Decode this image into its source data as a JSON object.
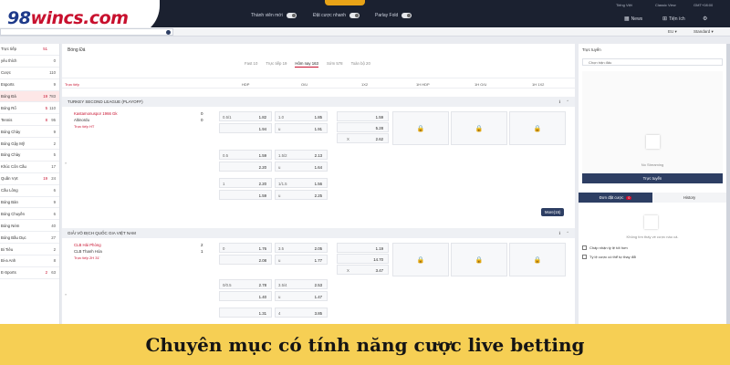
{
  "brand": {
    "logo_prefix": "98",
    "logo_rest": "wincs.com"
  },
  "topbar": {
    "toggles": [
      {
        "label": "Thành viên mới"
      },
      {
        "label": "Đặt cược nhanh"
      },
      {
        "label": "Parlay Fold"
      }
    ],
    "top_right": {
      "lang": "Tiếng Việt",
      "view": "Classic View",
      "time": "GMT+08:00"
    },
    "icons": [
      {
        "label": "News",
        "icon": "news-icon"
      },
      {
        "label": "Tiện ích",
        "icon": "apps-icon"
      },
      {
        "label": "Settings",
        "icon": "gear-icon"
      }
    ],
    "odds_format": "EU",
    "market_mode": "Standard"
  },
  "search": {
    "placeholder": ""
  },
  "sidebar": {
    "items": [
      {
        "label": "Trực tiếp",
        "n1": "51",
        "n2": ""
      },
      {
        "label": "yêu thích",
        "n1": "",
        "n2": "0"
      },
      {
        "label": "Cược",
        "n1": "",
        "n2": "110"
      },
      {
        "label": "Esports",
        "n1": "",
        "n2": "9"
      },
      {
        "label": "Bóng Đá",
        "n1": "19",
        "n2": "783"
      },
      {
        "label": "Bóng Rổ",
        "n1": "5",
        "n2": "110"
      },
      {
        "label": "Tennis",
        "n1": "8",
        "n2": "95"
      },
      {
        "label": "Bóng Chày",
        "n1": "",
        "n2": "9"
      },
      {
        "label": "Bóng Gậy Mỹ",
        "n1": "",
        "n2": "2"
      },
      {
        "label": "Bóng Chày",
        "n1": "",
        "n2": "5"
      },
      {
        "label": "Khúc Côn Cầu",
        "n1": "",
        "n2": "17"
      },
      {
        "label": "Quần Vợt",
        "n1": "19",
        "n2": "24"
      },
      {
        "label": "Cầu Lông",
        "n1": "",
        "n2": "6"
      },
      {
        "label": "Bóng Bàn",
        "n1": "",
        "n2": "9"
      },
      {
        "label": "Bóng Chuyền",
        "n1": "",
        "n2": "6"
      },
      {
        "label": "Bóng Ném",
        "n1": "",
        "n2": "40"
      },
      {
        "label": "Bóng Bầu Dục",
        "n1": "",
        "n2": "27"
      },
      {
        "label": "Bi Tiêu",
        "n1": "",
        "n2": "2"
      },
      {
        "label": "Bi-a Anh",
        "n1": "",
        "n2": "8"
      },
      {
        "label": "E-Sports",
        "n1": "2",
        "n2": "63"
      }
    ]
  },
  "main": {
    "title": "Bóng Đá",
    "tabs": [
      {
        "label": "Fast 10",
        "active": false
      },
      {
        "label": "Trực tiếp 19",
        "active": false
      },
      {
        "label": "Hôm nay 163",
        "active": true
      },
      {
        "label": "Sớm 578",
        "active": false
      },
      {
        "label": "Toàn bộ 20",
        "active": false
      }
    ],
    "columns": [
      "Trực tiếp",
      "HDP",
      "O/U",
      "1X2",
      "1H HDP",
      "1H O/U",
      "1H 1X2"
    ]
  },
  "leagues": [
    {
      "name": "TURKEY SECOND LEAGUE (PLAYOFF)",
      "home": "Kastamonuspor 1966 Gk",
      "away": "Altinordu",
      "home_score": "0",
      "away_score": "0",
      "live_label": "Trực tiếp",
      "live_time": "HT",
      "more": "More(15)",
      "hdp": [
        {
          "h": "0.5/1",
          "v": "1.82"
        },
        {
          "h": "",
          "v": "1.94"
        },
        {
          "h": "0.5",
          "v": "1.59"
        },
        {
          "h": "",
          "v": "2.20"
        },
        {
          "h": "1",
          "v": "2.20"
        },
        {
          "h": "",
          "v": "1.59"
        }
      ],
      "ou": [
        {
          "h": "1.0",
          "v": "1.85"
        },
        {
          "h": "u",
          "v": "1.91"
        },
        {
          "h": "1.5/2",
          "v": "2.13"
        },
        {
          "h": "u",
          "v": "1.64"
        },
        {
          "h": "1/1.5",
          "v": "1.56"
        },
        {
          "h": "u",
          "v": "2.25"
        }
      ],
      "x12": [
        {
          "h": "",
          "v": "1.59"
        },
        {
          "h": "",
          "v": "5.28"
        },
        {
          "h": "X",
          "v": "2.62"
        }
      ]
    },
    {
      "name": "GIẢI VÔ ĐỊCH QUỐC GIA VIỆT NAM",
      "home": "CLB Hải Phòng",
      "away": "CLB Thanh Hóa",
      "home_score": "2",
      "away_score": "1",
      "live_label": "Trực tiếp",
      "live_time": "2H 31'",
      "hdp": [
        {
          "h": "0",
          "v": "1.76"
        },
        {
          "h": "",
          "v": "2.08"
        },
        {
          "h": "0/0.5",
          "v": "2.78"
        },
        {
          "h": "",
          "v": "1.40"
        },
        {
          "h": "",
          "v": "1.31"
        }
      ],
      "ou": [
        {
          "h": "3.5",
          "v": "2.05"
        },
        {
          "h": "u",
          "v": "1.77"
        },
        {
          "h": "3.5/4",
          "v": "2.53"
        },
        {
          "h": "u",
          "v": "1.47"
        },
        {
          "h": "4",
          "v": "3.85"
        }
      ],
      "x12": [
        {
          "h": "",
          "v": "1.19"
        },
        {
          "h": "",
          "v": "14.70"
        },
        {
          "h": "X",
          "v": "3.47"
        }
      ]
    }
  ],
  "right_panel": {
    "title": "Trực tuyến",
    "select": "Chọn trận đấu",
    "no_streaming": "No Streaming",
    "button": "Trực tuyến",
    "tabs": [
      {
        "label": "Đơn đặt cược",
        "badge": "0"
      },
      {
        "label": "History"
      }
    ],
    "empty": "Không tìm thấy vé cược nào cả.",
    "checks": [
      "Chấp nhận tỷ lệ tốt hơn",
      "Tỷ lệ cược có thể tự thay đổi"
    ]
  },
  "caption": "Chuyên mục có tính năng cược live betting",
  "colors": {
    "brand_red": "#c8102e",
    "navy": "#2d3e63",
    "caption_bg": "#f6cf54"
  }
}
